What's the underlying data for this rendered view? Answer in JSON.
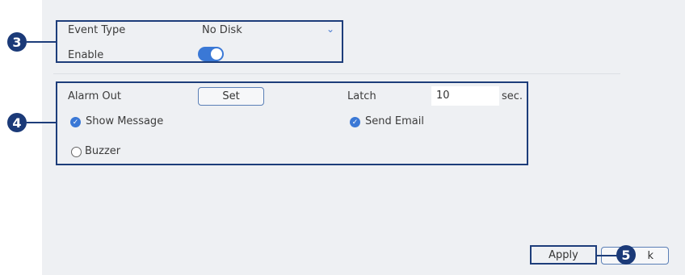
{
  "event": {
    "event_type_label": "Event Type",
    "event_type_value": "No Disk",
    "enable_label": "Enable",
    "enable_on": true
  },
  "alarm": {
    "alarm_out_label": "Alarm Out",
    "set_button": "Set",
    "latch_label": "Latch",
    "latch_value": "10",
    "latch_unit": "sec.",
    "show_message_label": "Show Message",
    "show_message_checked": true,
    "send_email_label": "Send Email",
    "send_email_checked": true,
    "buzzer_label": "Buzzer",
    "buzzer_checked": false
  },
  "footer": {
    "apply_button": "Apply",
    "back_button_visible": "k"
  },
  "callouts": [
    "3",
    "4",
    "5"
  ],
  "colors": {
    "accent": "#3a78d6",
    "callout": "#1b3a78",
    "panel": "#eef0f3"
  }
}
